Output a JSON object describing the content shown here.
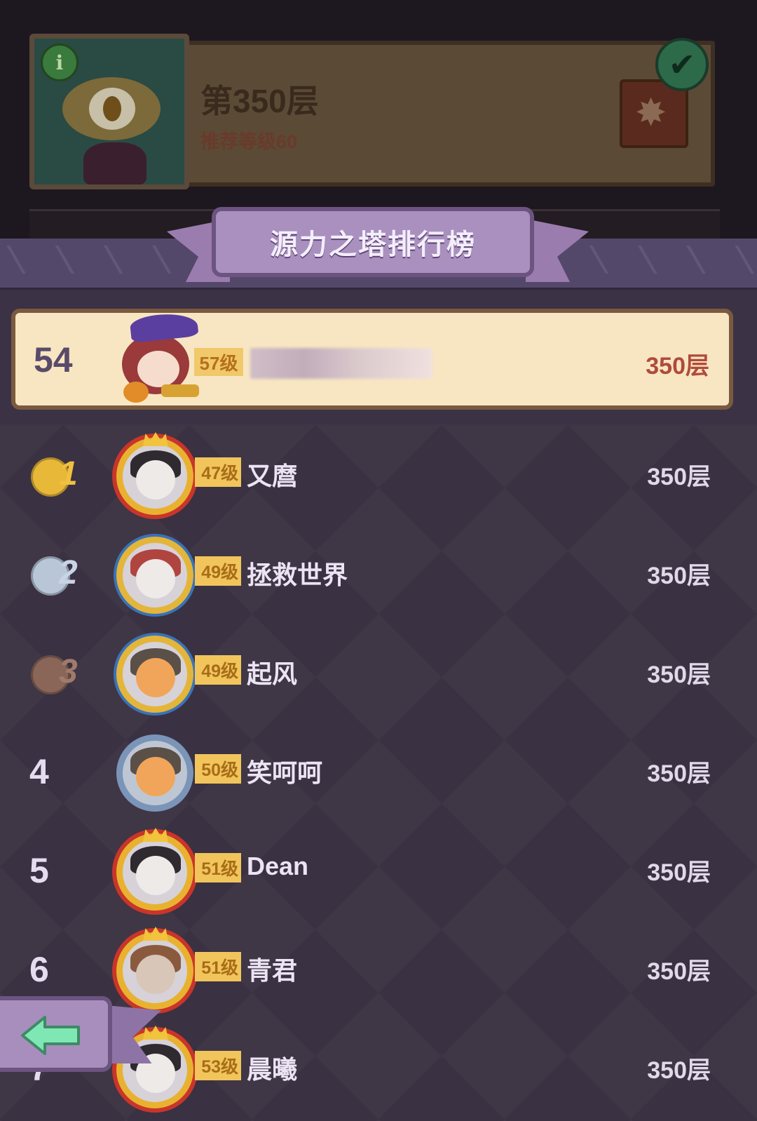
{
  "floor_card": {
    "title": "第350层",
    "subtitle": "推荐等级60",
    "info_icon": "info-icon",
    "check_icon": "check-icon"
  },
  "leaderboard": {
    "title": "源力之塔排行榜",
    "my_rank": {
      "rank": "54",
      "level": "57级",
      "floor": "350层"
    },
    "rows": [
      {
        "rank": "1",
        "medal": "gold",
        "level": "47级",
        "name": "又麿",
        "floor": "350层"
      },
      {
        "rank": "2",
        "medal": "silver",
        "level": "49级",
        "name": "拯救世界",
        "floor": "350层"
      },
      {
        "rank": "3",
        "medal": "bronze",
        "level": "49级",
        "name": "起风",
        "floor": "350层"
      },
      {
        "rank": "4",
        "medal": "",
        "level": "50级",
        "name": "笑呵呵",
        "floor": "350层"
      },
      {
        "rank": "5",
        "medal": "",
        "level": "51级",
        "name": "Dean",
        "floor": "350层"
      },
      {
        "rank": "6",
        "medal": "",
        "level": "51级",
        "name": "青君",
        "floor": "350层"
      },
      {
        "rank": "7",
        "medal": "",
        "level": "53级",
        "name": "晨曦",
        "floor": "350层"
      }
    ]
  },
  "back_button": {
    "icon": "back-arrow-icon"
  },
  "colors": {
    "panel": "#3b3246",
    "ribbon": "#a990bf",
    "my_row": "#f8e6c2",
    "level_badge": "#f1c55c",
    "my_floor": "#b04a3c"
  }
}
